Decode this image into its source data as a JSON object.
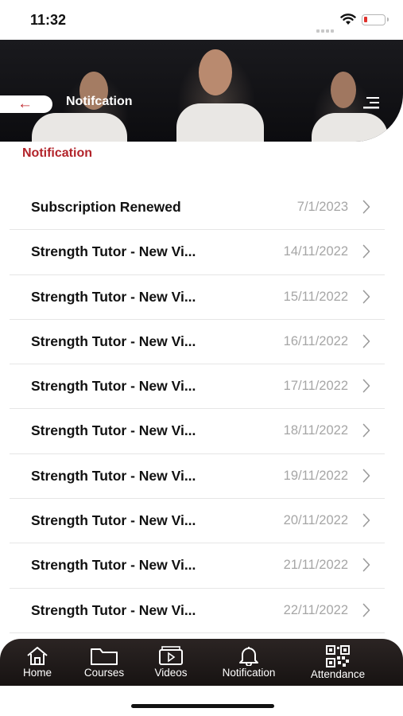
{
  "status_bar": {
    "time": "11:32"
  },
  "header": {
    "title": "Notifcation"
  },
  "section": {
    "title": "Notification"
  },
  "notifications": [
    {
      "title": "Subscription Renewed",
      "date": "7/1/2023"
    },
    {
      "title": "Strength Tutor - New Vi...",
      "date": "14/11/2022"
    },
    {
      "title": "Strength Tutor - New Vi...",
      "date": "15/11/2022"
    },
    {
      "title": "Strength Tutor - New Vi...",
      "date": "16/11/2022"
    },
    {
      "title": "Strength Tutor - New Vi...",
      "date": "17/11/2022"
    },
    {
      "title": "Strength Tutor - New Vi...",
      "date": "18/11/2022"
    },
    {
      "title": "Strength Tutor - New Vi...",
      "date": "19/11/2022"
    },
    {
      "title": "Strength Tutor - New Vi...",
      "date": "20/11/2022"
    },
    {
      "title": "Strength Tutor - New Vi...",
      "date": "21/11/2022"
    },
    {
      "title": "Strength Tutor - New Vi...",
      "date": "22/11/2022"
    }
  ],
  "tabbar": {
    "items": [
      {
        "label": "Home",
        "icon": "home-icon"
      },
      {
        "label": "Courses",
        "icon": "folder-icon"
      },
      {
        "label": "Videos",
        "icon": "video-icon"
      },
      {
        "label": "Notification",
        "icon": "bell-icon"
      },
      {
        "label": "Attendance",
        "icon": "qr-code-icon"
      }
    ]
  },
  "colors": {
    "accent": "#b2232a",
    "tabbar": "#1f1a19"
  }
}
